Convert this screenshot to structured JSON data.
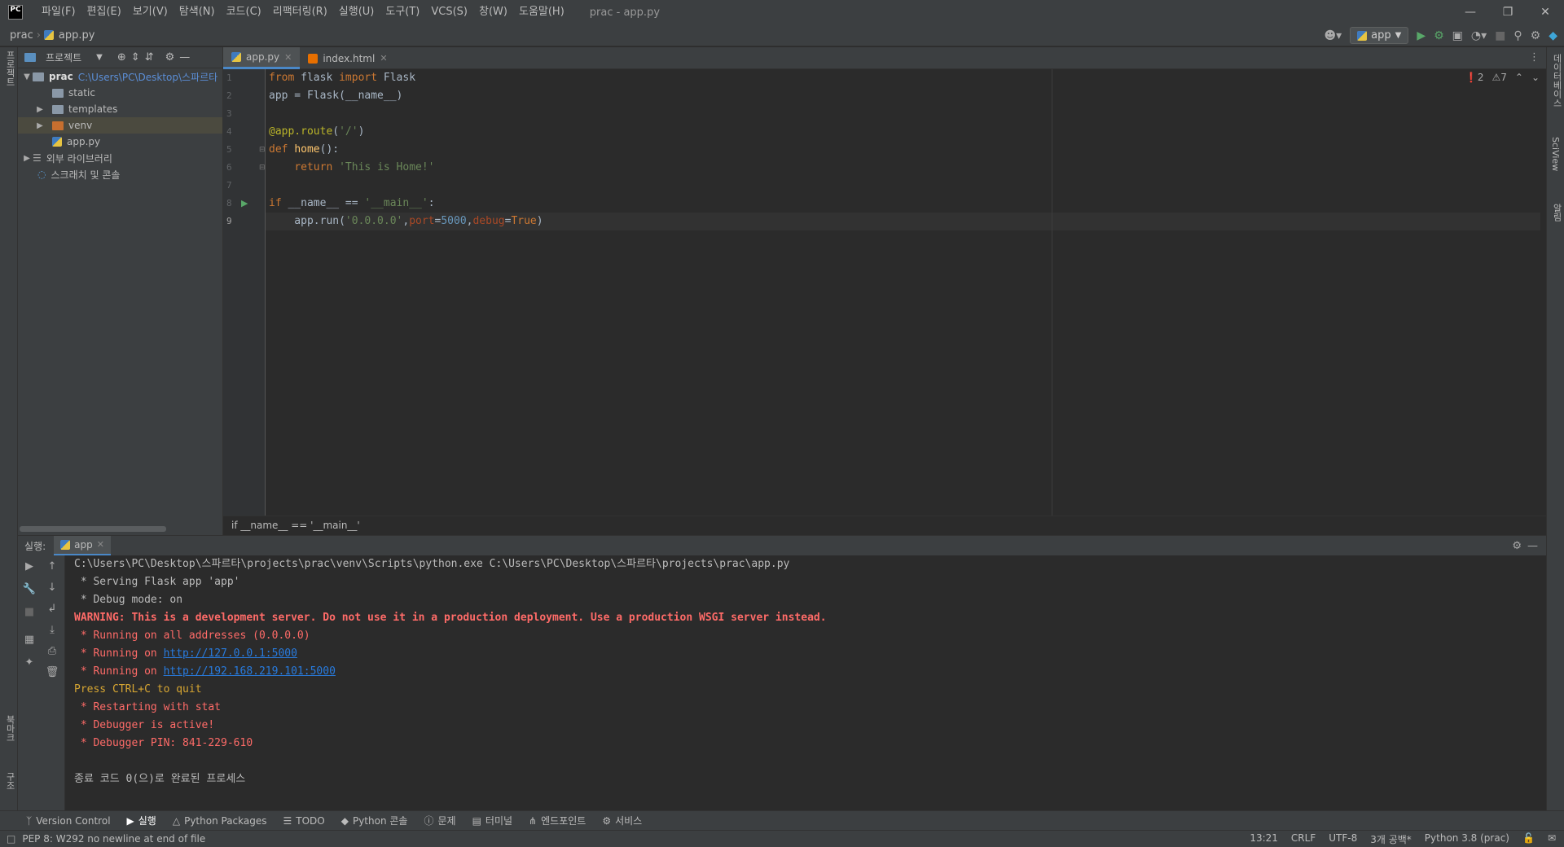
{
  "titlebar": {
    "logo": "PC",
    "menus": [
      "파일(F)",
      "편집(E)",
      "보기(V)",
      "탐색(N)",
      "코드(C)",
      "리팩터링(R)",
      "실행(U)",
      "도구(T)",
      "VCS(S)",
      "창(W)",
      "도움말(H)"
    ],
    "title": "prac - app.py"
  },
  "navbar": {
    "project": "prac",
    "file": "app.py",
    "run_config": "app"
  },
  "left_stripe": {
    "project": "프로젝트",
    "bookmarks": "북마크",
    "structure": "구조"
  },
  "right_stripe": {
    "database": "데이터베이스",
    "sciview": "SciView",
    "notifications": "알림"
  },
  "project_panel": {
    "title": "프로젝트",
    "root": "prac",
    "root_path": "C:\\Users\\PC\\Desktop\\스파르타",
    "items": [
      "static",
      "templates",
      "venv",
      "app.py"
    ],
    "external": "외부 라이브러리",
    "scratches": "스크래치 및 콘솔"
  },
  "editor": {
    "tabs": [
      "app.py",
      "index.html"
    ],
    "errors": "2",
    "warnings": "7",
    "lines": [
      "from flask import Flask",
      "app = Flask(__name__)",
      "",
      "@app.route('/')",
      "def home():",
      "    return 'This is Home!'",
      "",
      "if __name__ == '__main__':",
      "    app.run('0.0.0.0',port=5000,debug=True)"
    ],
    "breadcrumb": "if __name__ == '__main__'"
  },
  "run": {
    "label": "실행:",
    "tab": "app",
    "console": [
      {
        "text": "C:\\Users\\PC\\Desktop\\스파르타\\projects\\prac\\venv\\Scripts\\python.exe C:\\Users\\PC\\Desktop\\스파르타\\projects\\prac\\app.py",
        "style": "normal"
      },
      {
        "text": " * Serving Flask app 'app'",
        "style": "normal"
      },
      {
        "text": " * Debug mode: on",
        "style": "normal"
      },
      {
        "text": "WARNING: This is a development server. Do not use it in a production deployment. Use a production WSGI server instead.",
        "style": "red-bold"
      },
      {
        "text": " * Running on all addresses (0.0.0.0)",
        "style": "red"
      },
      {
        "text": " * Running on ",
        "link": "http://127.0.0.1:5000",
        "style": "red"
      },
      {
        "text": " * Running on ",
        "link": "http://192.168.219.101:5000",
        "style": "red"
      },
      {
        "text": "Press CTRL+C to quit",
        "style": "yellow"
      },
      {
        "text": " * Restarting with stat",
        "style": "red"
      },
      {
        "text": " * Debugger is active!",
        "style": "red"
      },
      {
        "text": " * Debugger PIN: 841-229-610",
        "style": "red"
      },
      {
        "text": "",
        "style": "normal"
      },
      {
        "text": "종료 코드 0(으)로 완료된 프로세스",
        "style": "normal"
      }
    ]
  },
  "bottom_tools": [
    "Version Control",
    "실행",
    "Python Packages",
    "TODO",
    "Python 콘솔",
    "문제",
    "터미널",
    "엔드포인트",
    "서비스"
  ],
  "statusbar": {
    "message": "PEP 8: W292 no newline at end of file",
    "position": "13:21",
    "line_sep": "CRLF",
    "encoding": "UTF-8",
    "indent": "3개 공백*",
    "interpreter": "Python 3.8 (prac)"
  }
}
